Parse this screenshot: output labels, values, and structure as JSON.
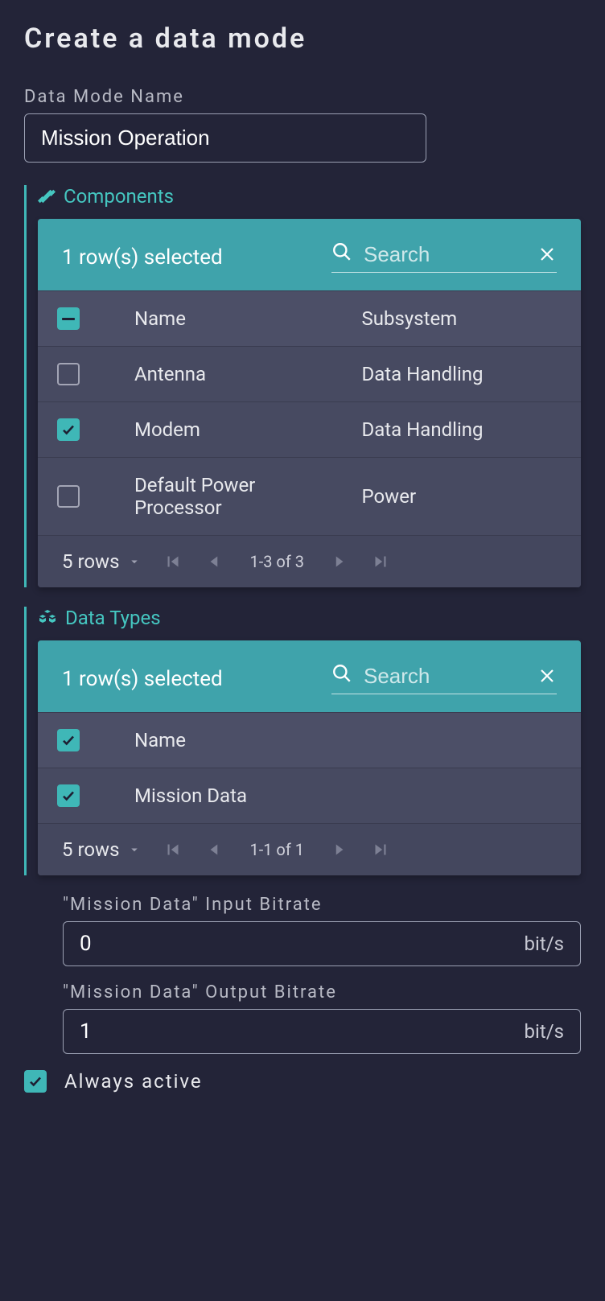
{
  "title": "Create a data mode",
  "name_field": {
    "label": "Data Mode Name",
    "value": "Mission Operation"
  },
  "components": {
    "heading": "Components",
    "selected_text": "1 row(s) selected",
    "search_placeholder": "Search",
    "columns": [
      "Name",
      "Subsystem"
    ],
    "header_checkbox_state": "indeterminate",
    "rows": [
      {
        "checked": false,
        "name": "Antenna",
        "subsystem": "Data Handling"
      },
      {
        "checked": true,
        "name": "Modem",
        "subsystem": "Data Handling"
      },
      {
        "checked": false,
        "name": "Default Power Processor",
        "subsystem": "Power"
      }
    ],
    "page_size_label": "5 rows",
    "range_text": "1-3 of 3"
  },
  "data_types": {
    "heading": "Data Types",
    "selected_text": "1 row(s) selected",
    "search_placeholder": "Search",
    "columns": [
      "Name"
    ],
    "header_checkbox_state": "checked",
    "rows": [
      {
        "checked": true,
        "name": "Mission Data"
      }
    ],
    "page_size_label": "5 rows",
    "range_text": "1-1 of 1"
  },
  "input_bitrate": {
    "label": "\"Mission Data\" Input Bitrate",
    "value": "0",
    "unit": "bit/s"
  },
  "output_bitrate": {
    "label": "\"Mission Data\" Output Bitrate",
    "value": "1",
    "unit": "bit/s"
  },
  "always_active": {
    "label": "Always active",
    "checked": true
  }
}
